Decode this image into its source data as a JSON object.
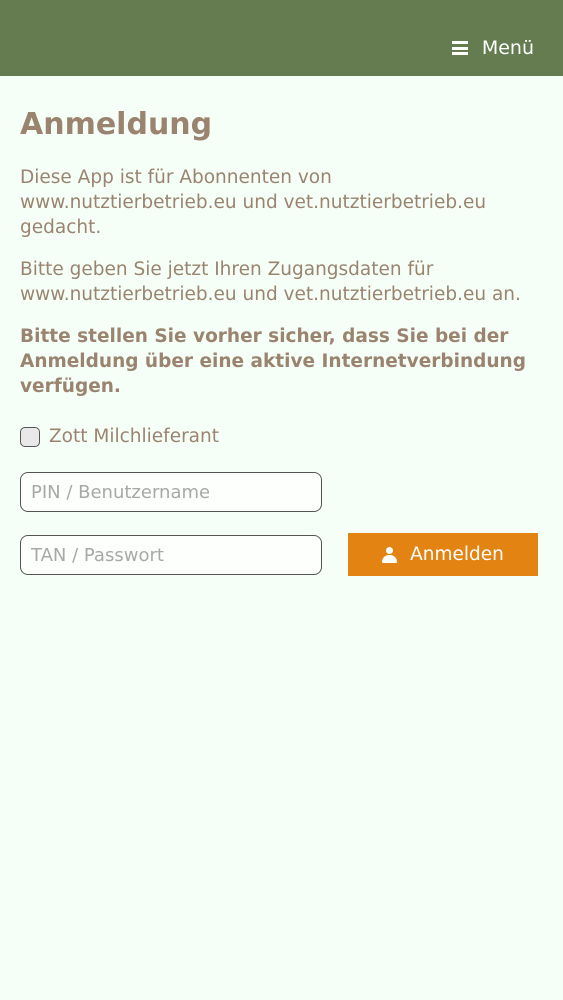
{
  "header": {
    "menu_label": "Menü",
    "menu_icon": "hamburger-icon",
    "bar_color": "#647c4f"
  },
  "main": {
    "title": "Anmeldung",
    "intro_line1": "Diese App ist für Abonnenten von",
    "intro_line2": "www.nutztierbetrieb.eu und vet.nutztierbetrieb.eu",
    "intro_line3": "gedacht.",
    "instructions_line1": "Bitte geben Sie jetzt Ihren Zugangsdaten für",
    "instructions_line2": "www.nutztierbetrieb.eu und vet.nutztierbetrieb.eu an.",
    "warning_line1": "Bitte stellen Sie vorher sicher, dass Sie bei der",
    "warning_line2": "Anmeldung über eine aktive Internetverbindung",
    "warning_line3": "verfügen."
  },
  "form": {
    "checkbox_label": "Zott Milchlieferant",
    "checkbox_checked": false,
    "pin_placeholder": "PIN / Benutzername",
    "pin_value": "",
    "tan_placeholder": "TAN / Passwort",
    "tan_value": "",
    "login_label": "Anmelden",
    "login_icon": "user-icon",
    "login_color": "#e28312"
  }
}
